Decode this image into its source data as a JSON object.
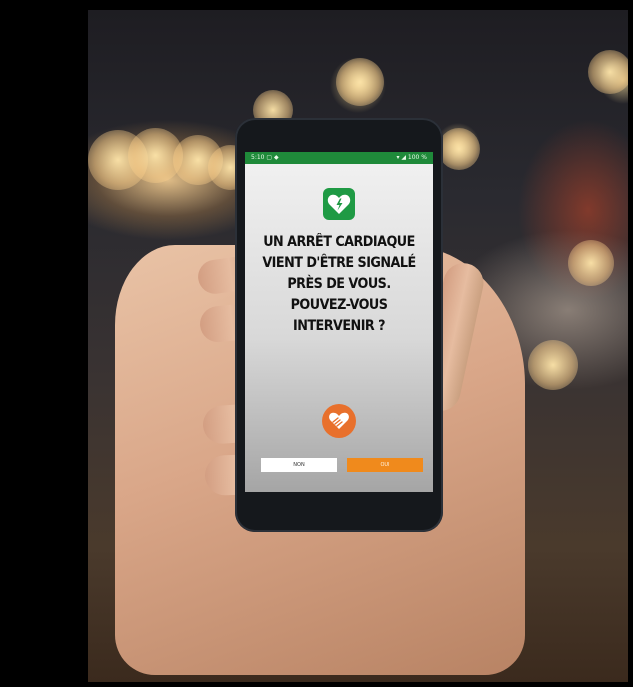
{
  "phone": {
    "status_left": "5:10 ▢ ◆",
    "status_right": "▾ ◢ 100 %",
    "message_lines": [
      "UN ARRÊT CARDIAQUE",
      "VIENT D'ÊTRE SIGNALÉ",
      "PRÈS DE VOUS.",
      "POUVEZ-VOUS",
      "INTERVENIR ?"
    ],
    "no_button_label": "NON",
    "yes_button_label": "OUI"
  },
  "icons": {
    "top": "defibrillator-heart-icon",
    "bottom": "hands-heart-icon"
  },
  "colors": {
    "status_bar": "#1f8a3a",
    "aed_icon": "#1f9a44",
    "hands_icon": "#e8702c",
    "yes_button": "#f08a1c"
  }
}
